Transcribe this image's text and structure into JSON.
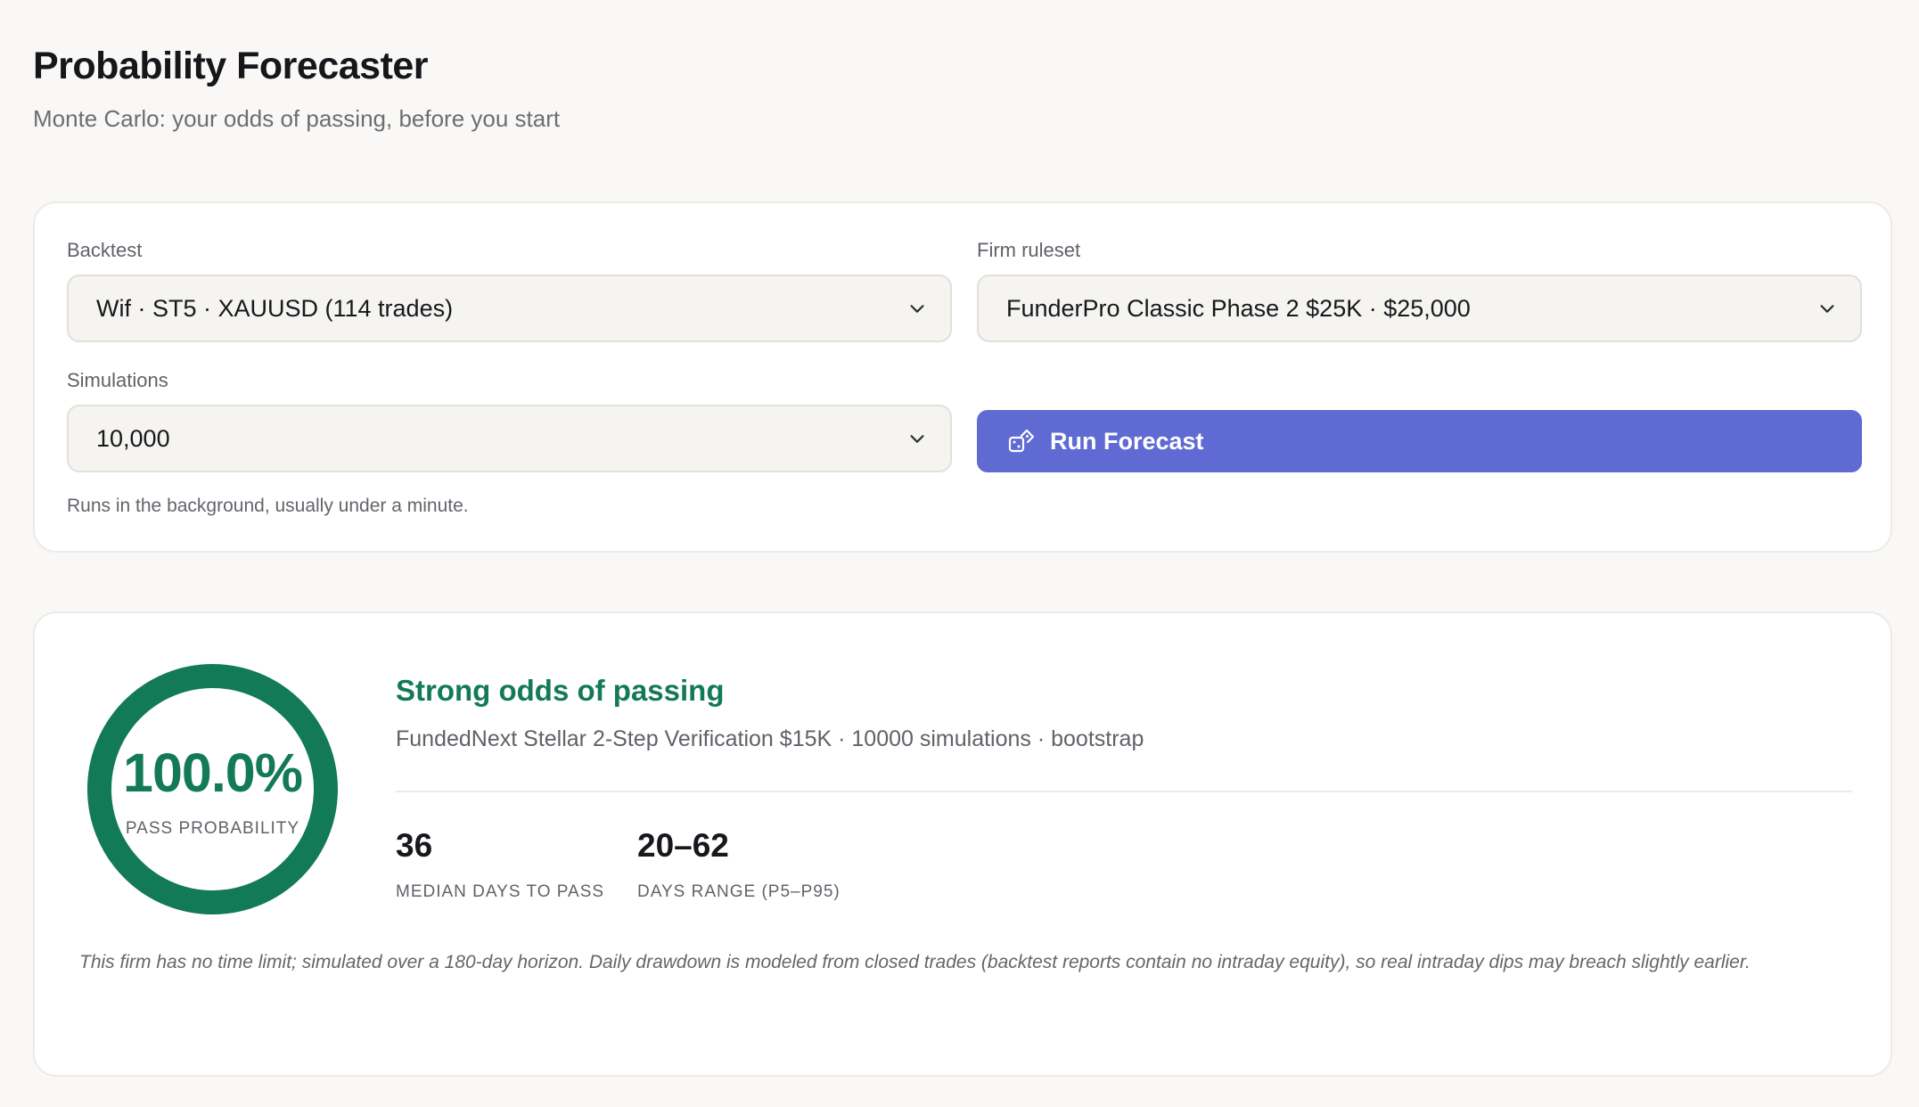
{
  "header": {
    "title": "Probability Forecaster",
    "subtitle": "Monte Carlo: your odds of passing, before you start"
  },
  "config": {
    "backtest": {
      "label": "Backtest",
      "value": "Wif · ST5 · XAUUSD (114 trades)"
    },
    "firm_ruleset": {
      "label": "Firm ruleset",
      "value": "FunderPro Classic Phase 2 $25K · $25,000"
    },
    "simulations": {
      "label": "Simulations",
      "value": "10,000"
    },
    "run_button_label": "Run Forecast",
    "hint": "Runs in the background, usually under a minute."
  },
  "result": {
    "pass_probability": 100.0,
    "pass_probability_text": "100.0%",
    "pass_probability_label": "PASS PROBABILITY",
    "verdict": "Strong odds of passing",
    "summary": "FundedNext Stellar 2-Step Verification $15K · 10000 simulations · bootstrap",
    "stats": [
      {
        "value": "36",
        "label": "MEDIAN DAYS TO PASS"
      },
      {
        "value": "20–62",
        "label": "DAYS RANGE (P5–P95)"
      }
    ],
    "footnote": "This firm has no time limit; simulated over a 180-day horizon. Daily drawdown is modeled from closed trades (backtest reports contain no intraday equity), so real intraday dips may breach slightly earlier."
  },
  "colors": {
    "accent": "#5f6bd3",
    "success": "#137a57",
    "gauge_track": "#e4efe9"
  },
  "icons": {
    "select_chevron": "chevron-down-icon",
    "run_button": "dice-icon"
  }
}
